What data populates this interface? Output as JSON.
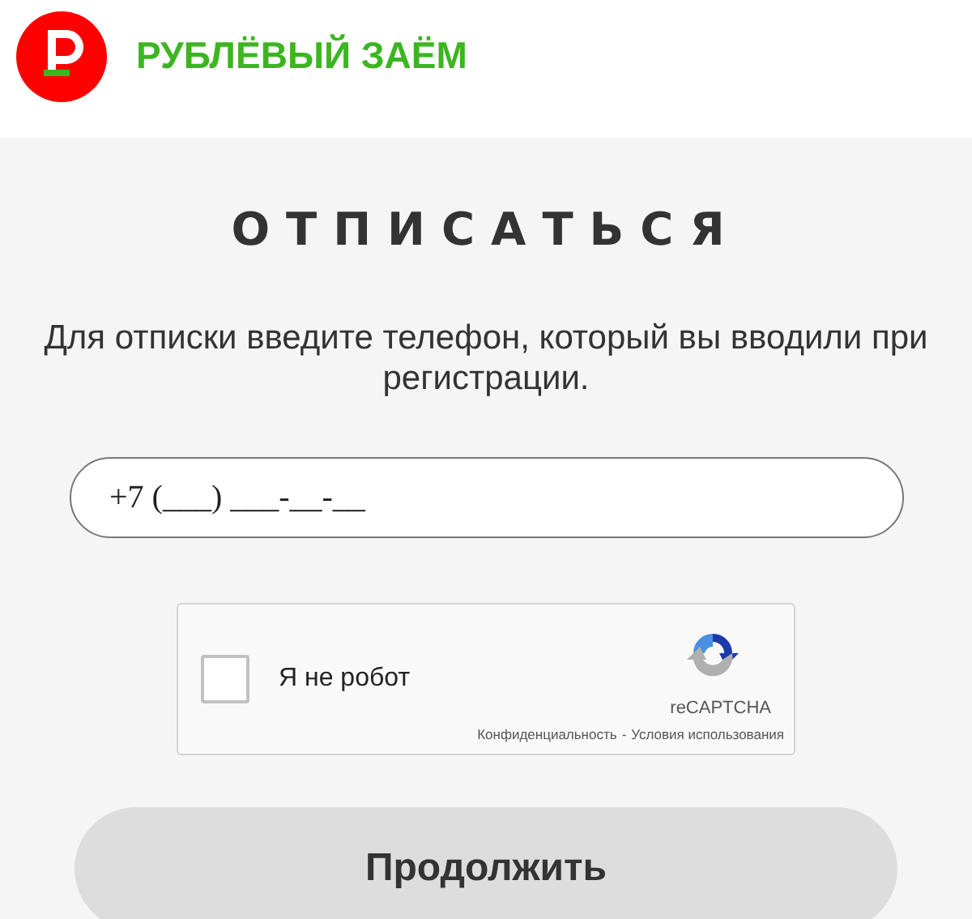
{
  "header": {
    "brand": "РУБЛЁВЫЙ ЗАЁМ"
  },
  "title": "ОТПИСАТЬСЯ",
  "description": "Для отписки введите телефон, который вы вводили при регистрации.",
  "phone_field": {
    "value": "+7 (___) ___-__-__"
  },
  "captcha": {
    "label": "Я не робот",
    "checked": false,
    "brand": "reCAPTCHA",
    "links": [
      "Конфиденциальность",
      "Условия использования"
    ],
    "separator": "-"
  },
  "buttons": [
    "Продолжить"
  ]
}
